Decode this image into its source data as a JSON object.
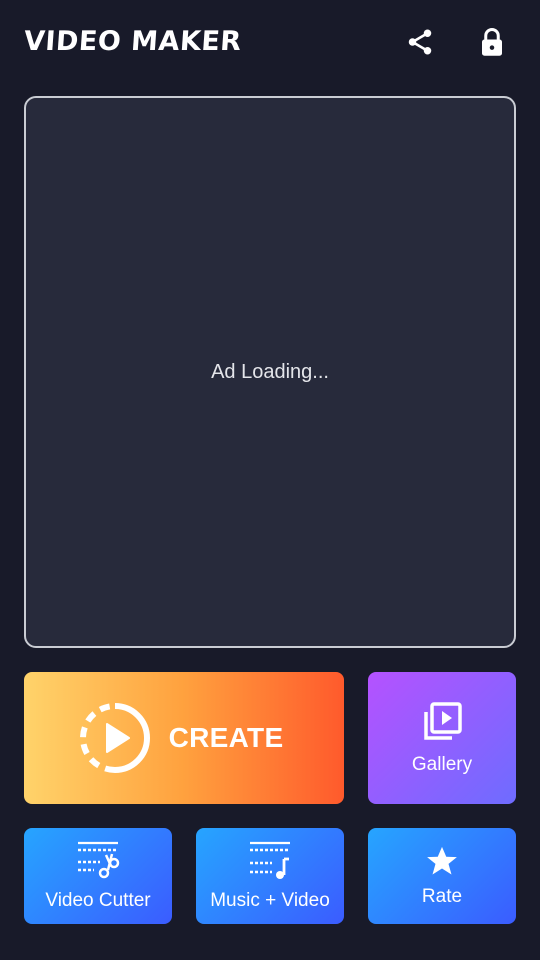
{
  "header": {
    "title": "VIDEO MAKER",
    "share_icon": "share-icon",
    "lock_icon": "lock-icon"
  },
  "ad": {
    "text": "Ad Loading..."
  },
  "actions": {
    "create": {
      "label": "CREATE",
      "icon": "play-circle-icon"
    },
    "gallery": {
      "label": "Gallery",
      "icon": "video-library-icon"
    },
    "video_cutter": {
      "label": "Video Cutter",
      "icon": "video-cut-icon"
    },
    "music_video": {
      "label": "Music + Video",
      "icon": "music-video-icon"
    },
    "rate": {
      "label": "Rate",
      "icon": "star-icon"
    }
  },
  "colors": {
    "background": "#181a29",
    "ad_background": "#272a3b",
    "create_gradient": [
      "#ffd36a",
      "#ff5a2c"
    ],
    "gallery_gradient": [
      "#b552ff",
      "#6e6cff"
    ],
    "small_tile_gradient": [
      "#26a5ff",
      "#3b5cff"
    ]
  }
}
